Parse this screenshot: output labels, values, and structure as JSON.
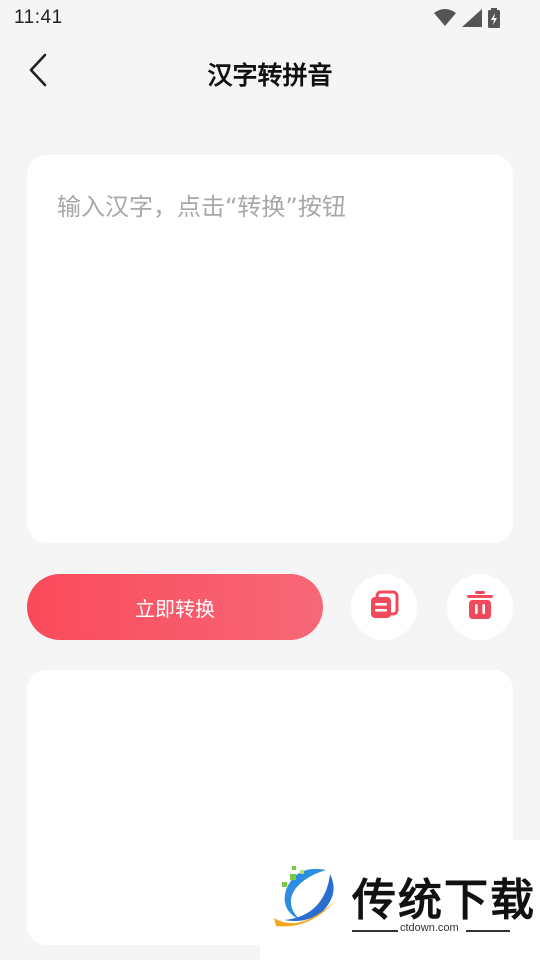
{
  "status_bar": {
    "time": "11:41",
    "icons": [
      "wifi-icon",
      "signal-icon",
      "battery-icon"
    ]
  },
  "header": {
    "back_icon": "chevron-left-icon",
    "title": "汉字转拼音"
  },
  "input": {
    "placeholder": "输入汉字，点击“转换”按钮",
    "value": ""
  },
  "actions": {
    "convert_label": "立即转换",
    "copy_icon": "copy-icon",
    "delete_icon": "trash-icon"
  },
  "output": {
    "text": ""
  },
  "watermark": {
    "title": "传统下载",
    "site": "ctdown.com"
  },
  "colors": {
    "accent": "#fa4a5a",
    "accent_end": "#f76878",
    "background": "#f5f5f5",
    "card": "#ffffff"
  }
}
